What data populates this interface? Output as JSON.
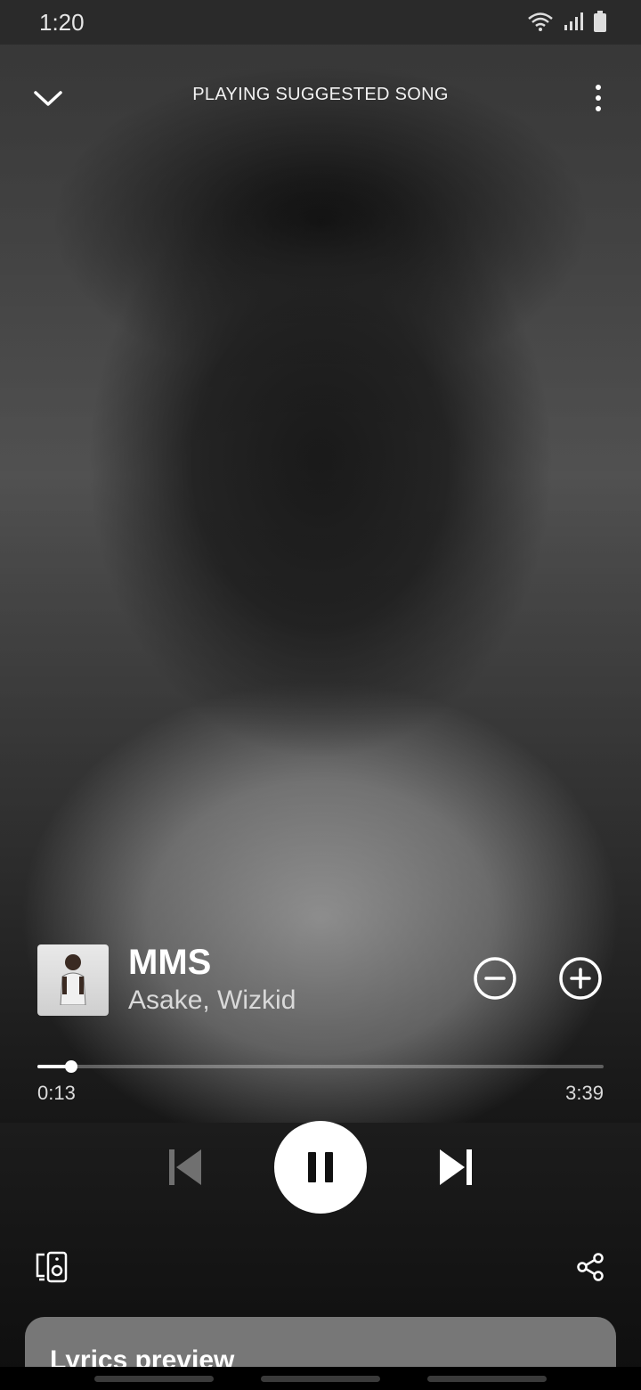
{
  "status_bar": {
    "time": "1:20"
  },
  "header": {
    "title": "PLAYING SUGGESTED SONG"
  },
  "track": {
    "title": "MMS",
    "artist": "Asake, Wizkid"
  },
  "playback": {
    "elapsed": "0:13",
    "total": "3:39",
    "progress_fraction": 0.059,
    "state": "playing"
  },
  "lyrics": {
    "title": "Lyrics preview"
  },
  "icons": {
    "collapse": "chevron-down-icon",
    "more": "more-vertical-icon",
    "remove": "minus-circle-icon",
    "add": "plus-circle-icon",
    "previous": "skip-previous-icon",
    "pause": "pause-icon",
    "next": "skip-next-icon",
    "devices": "connect-devices-icon",
    "share": "share-icon"
  },
  "colors": {
    "background": "#121212",
    "lyrics_card": "#777777",
    "text": "#ffffff"
  }
}
